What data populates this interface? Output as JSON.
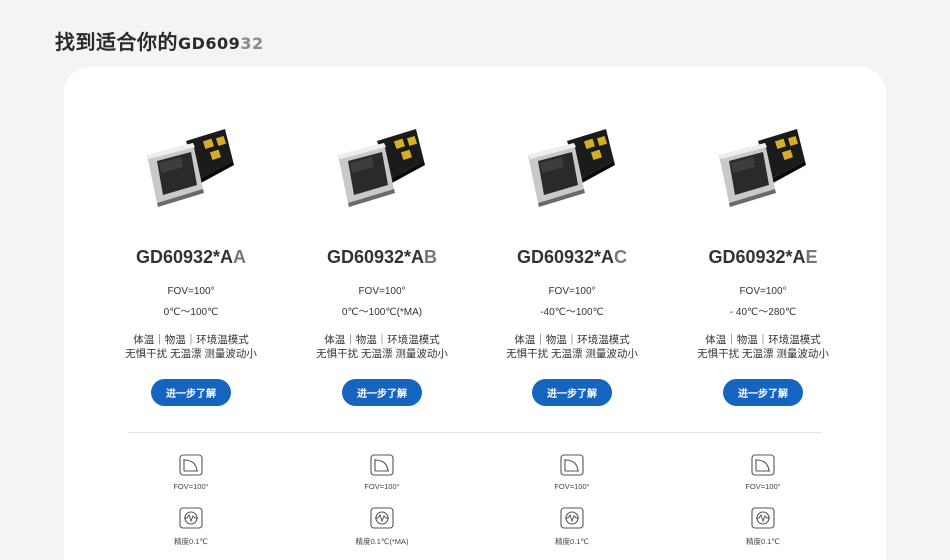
{
  "page": {
    "title_text": "找到适合你的",
    "title_model_main": "GD609",
    "title_model_fade": "32"
  },
  "products": [
    {
      "name_main": "GD60932*A",
      "name_suffix": "A",
      "fov": "FOV=100°",
      "range": "0℃～100℃",
      "modes": "体温｜物温｜环境温模式",
      "features": "无惧干扰 无温漂 测量波动小",
      "button": "进一步了解",
      "spec_fov": "FOV=100°",
      "spec_precision": "精度0.1℃"
    },
    {
      "name_main": "GD60932*A",
      "name_suffix": "B",
      "fov": "FOV=100°",
      "range": "0℃～100℃(*MA)",
      "modes": "体温｜物温｜环境温模式",
      "features": "无惧干扰 无温漂 测量波动小",
      "button": "进一步了解",
      "spec_fov": "FOV=100°",
      "spec_precision": "精度0.1℃(*MA)"
    },
    {
      "name_main": "GD60932*A",
      "name_suffix": "C",
      "fov": "FOV=100°",
      "range": "-40℃～100℃",
      "modes": "体温｜物温｜环境温模式",
      "features": "无惧干扰 无温漂 测量波动小",
      "button": "进一步了解",
      "spec_fov": "FOV=100°",
      "spec_precision": "精度0.1℃"
    },
    {
      "name_main": "GD60932*A",
      "name_suffix": "E",
      "fov": "FOV=100°",
      "range": "- 40℃～280℃",
      "modes": "体温｜物温｜环境温模式",
      "features": "无惧干扰 无温漂 测量波动小",
      "button": "进一步了解",
      "spec_fov": "FOV=100°",
      "spec_precision": "精度0.1℃"
    }
  ],
  "icons": {
    "fov": "fov-angle-icon",
    "precision": "precision-gauge-icon",
    "chip": "sensor-chip-image"
  },
  "colors": {
    "button": "#1565c0",
    "background": "#f4f4f4",
    "card": "#ffffff"
  }
}
